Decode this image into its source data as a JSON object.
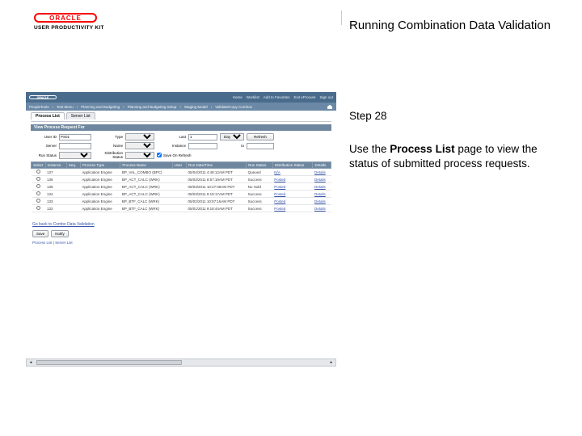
{
  "header": {
    "brand": "ORACLE",
    "subbrand": "USER PRODUCTIVITY KIT",
    "title": "Running Combination Data Validation"
  },
  "step": {
    "label": "Step 28",
    "text_before": "Use the ",
    "text_bold": "Process List",
    "text_after": " page to view the status of submitted process requests."
  },
  "ps": {
    "brand": "ORACLE",
    "toplinks": [
      "Home",
      "Worklist",
      "Add to Favorites",
      "Exit eProcure",
      "Sign out"
    ],
    "breadcrumbs": [
      "PeopleTools",
      "Test Menu",
      "Planning and Budgeting",
      "Planning and Budgeting Setup",
      "Staging Model",
      "Validate/Copy Combos"
    ],
    "tabs": {
      "t1": "Process List",
      "t2": "Server List"
    },
    "filters_title": "View Process Request For",
    "filters": {
      "userid_label": "User ID",
      "userid": "PS01",
      "type_label": "Type",
      "type": "",
      "last_label": "Last",
      "last": "1",
      "range_label": "",
      "range": "Days",
      "refresh": "Refresh",
      "server_label": "Server",
      "server": "",
      "name_label": "Name",
      "name": "",
      "instance_label": "Instance",
      "instance": "",
      "to_label": "to",
      "to": "",
      "runstatus_label": "Run Status",
      "runstatus": "",
      "diststatus_label": "Distribution Status",
      "diststatus": "",
      "save_label": "Save On Refresh"
    },
    "grid": {
      "headers": [
        "Select",
        "Instance",
        "Seq.",
        "Process Type",
        "Process Name",
        "User",
        "Run Date/Time",
        "Run Status",
        "Distribution Status",
        "Details"
      ],
      "rows": [
        {
          "sel": false,
          "inst": "137",
          "seq": "",
          "ptype": "Application Engine",
          "pname": "BP_VAL_COMBO (BPC)",
          "user": "",
          "dt": "05/04/2011  4:48:12AM PDT",
          "rs": "Queued",
          "ds": "N/A",
          "det": "Details"
        },
        {
          "sel": false,
          "inst": "136",
          "seq": "",
          "ptype": "Application Engine",
          "pname": "BP_ACT_CALC  (WRK)",
          "user": "",
          "dt": "05/03/2011  8:57:19AM PDT",
          "rs": "Success",
          "ds": "Posted",
          "det": "Details"
        },
        {
          "sel": false,
          "inst": "135",
          "seq": "",
          "ptype": "Application Engine",
          "pname": "BP_ACT_CALC  (WRK)",
          "user": "",
          "dt": "05/03/2011 10:27:08AM PDT",
          "rs": "No Hold",
          "ds": "Posted",
          "det": "Details"
        },
        {
          "sel": false,
          "inst": "134",
          "seq": "",
          "ptype": "Application Engine",
          "pname": "BP_ACT_CALC  (WRK)",
          "user": "",
          "dt": "05/03/2011  9:19:17AM PDT",
          "rs": "Success",
          "ds": "Posted",
          "det": "Details"
        },
        {
          "sel": false,
          "inst": "133",
          "seq": "",
          "ptype": "Application Engine",
          "pname": "BP_BTF_CALC (WRK)",
          "user": "",
          "dt": "05/02/2011 10:57:16AM PDT",
          "rs": "Success",
          "ds": "Posted",
          "det": "Details"
        },
        {
          "sel": false,
          "inst": "132",
          "seq": "",
          "ptype": "Application Engine",
          "pname": "BP_BTF_CALC (WRK)",
          "user": "",
          "dt": "05/01/2011  9:18:44AM PDT",
          "rs": "Success",
          "ds": "Posted",
          "det": "Details"
        }
      ]
    },
    "backlink": "Go back to Combo Data Validation",
    "buttons": {
      "save": "Save",
      "notify": "Notify"
    },
    "bottom_tabs": "Process List | Server List"
  }
}
